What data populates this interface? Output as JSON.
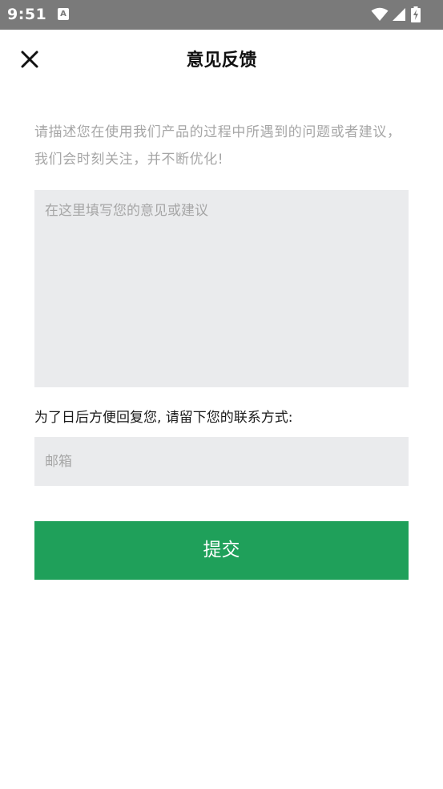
{
  "status_bar": {
    "time": "9:51",
    "notification_glyph": "A",
    "icons": [
      "wifi-icon",
      "signal-icon",
      "battery-charging-icon"
    ]
  },
  "header": {
    "title": "意见反馈",
    "close_icon": "close-icon"
  },
  "form": {
    "description": "请描述您在使用我们产品的过程中所遇到的问题或者建议，我们会时刻关注，并不断优化!",
    "feedback_placeholder": "在这里填写您的意见或建议",
    "feedback_value": "",
    "contact_prompt": "为了日后方便回复您, 请留下您的联系方式:",
    "email_placeholder": "邮箱",
    "email_value": "",
    "submit_label": "提交"
  },
  "colors": {
    "status_bar_bg": "#7a7a7a",
    "accent_green": "#1fa05a",
    "input_bg": "#eaebed",
    "hint_text": "#a6a6a6"
  }
}
